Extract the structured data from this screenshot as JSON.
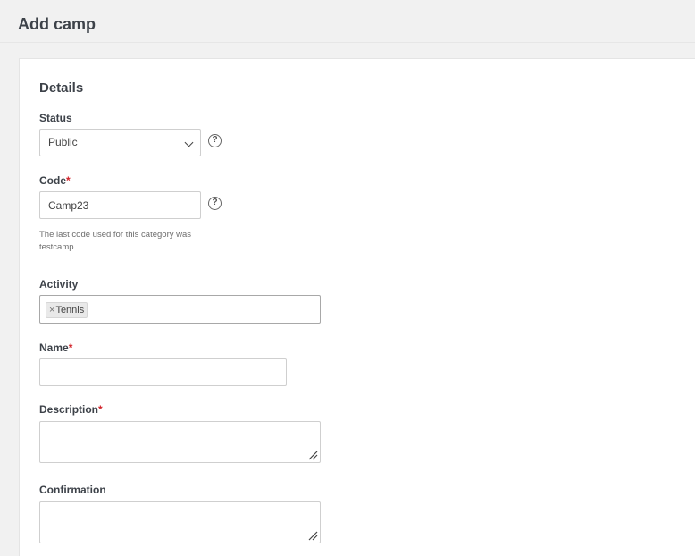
{
  "header": {
    "title": "Add camp"
  },
  "form": {
    "section_title": "Details",
    "status": {
      "label": "Status",
      "value": "Public",
      "help_icon": "question-circle-icon"
    },
    "code": {
      "label": "Code",
      "required_mark": "*",
      "value": "Camp23",
      "help_icon": "question-circle-icon",
      "hint": "The last code used for this category was testcamp."
    },
    "activity": {
      "label": "Activity",
      "tags": [
        {
          "remove": "×",
          "label": "Tennis"
        }
      ]
    },
    "name": {
      "label": "Name",
      "required_mark": "*",
      "value": ""
    },
    "description": {
      "label": "Description",
      "required_mark": "*",
      "value": ""
    },
    "confirmation": {
      "label": "Confirmation",
      "value": ""
    }
  },
  "colors": {
    "required": "#d2232a",
    "background": "#f1f1f1",
    "card": "#ffffff"
  }
}
